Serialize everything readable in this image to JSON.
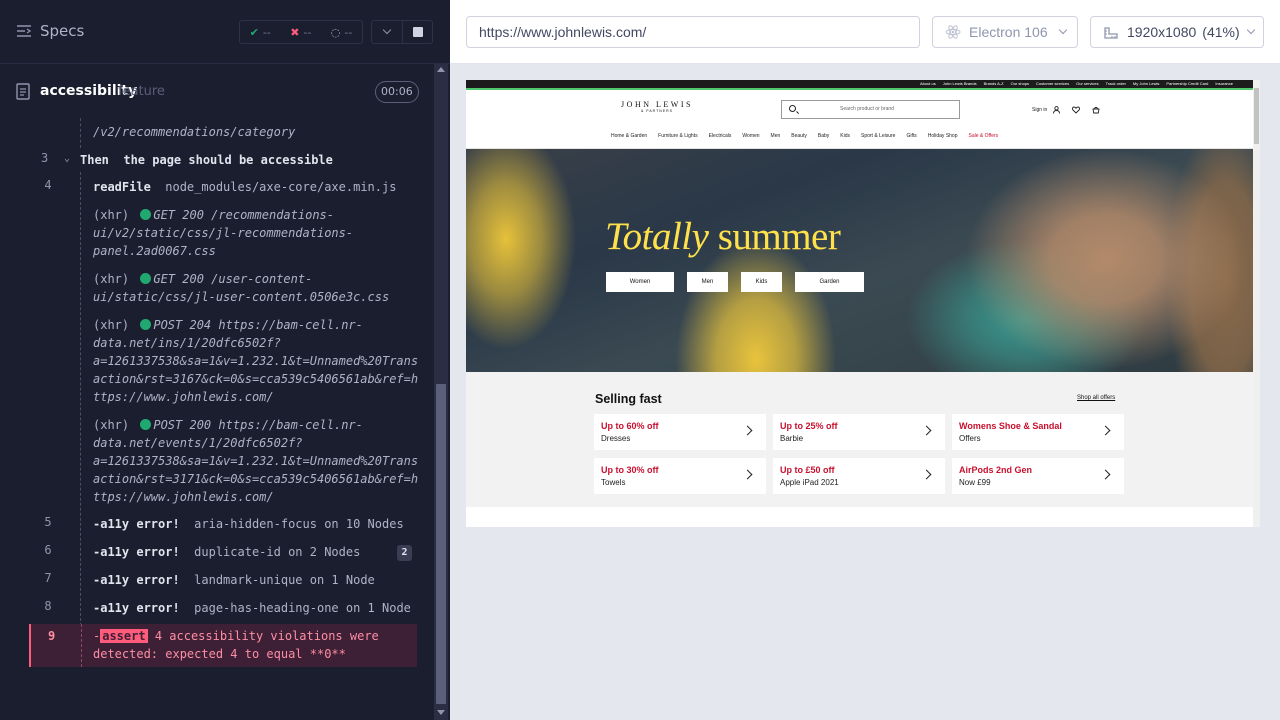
{
  "reporter": {
    "specs_label": "Specs",
    "stats": {
      "passed": "--",
      "failed": "--",
      "pending": "--"
    },
    "file": {
      "name": "accessibility",
      "ext": "feature",
      "duration": "00:06"
    },
    "log": {
      "prev_tail": "/v2/recommendations/category",
      "step3": {
        "num": "3",
        "keyword": "Then",
        "text": "the page should be accessible"
      },
      "step4": {
        "num": "4",
        "command": "readFile",
        "arg": "node_modules/axe-core/axe.min.js"
      },
      "xhr_label": "(xhr)",
      "xhr": [
        {
          "method": "GET 200",
          "lines": [
            "/recommendations-",
            "ui/v2/static/css/jl-recommendations-",
            "panel.2ad0067.css"
          ]
        },
        {
          "method": "GET 200",
          "lines": [
            "/user-content-",
            "ui/static/css/jl-user-content.0506e3c.css"
          ]
        },
        {
          "method": "POST 204",
          "lines": [
            "https://bam-cell.nr-",
            "data.net/ins/1/20dfc6502f?",
            "a=1261337538&sa=1&v=1.232.1&t=Unnamed%20Trans",
            "action&rst=3167&ck=0&s=cca539c5406561ab&ref=h",
            "ttps://www.johnlewis.com/"
          ]
        },
        {
          "method": "POST 200",
          "lines": [
            "https://bam-cell.nr-",
            "data.net/events/1/20dfc6502f?",
            "a=1261337538&sa=1&v=1.232.1&t=Unnamed%20Trans",
            "action&rst=3171&ck=0&s=cca539c5406561ab&ref=h",
            "ttps://www.johnlewis.com/"
          ]
        }
      ],
      "errors": [
        {
          "num": "5",
          "label": "-a11y error!",
          "msg": "aria-hidden-focus on 10 Nodes"
        },
        {
          "num": "6",
          "label": "-a11y error!",
          "msg": "duplicate-id on 2 Nodes",
          "badge": "2"
        },
        {
          "num": "7",
          "label": "-a11y error!",
          "msg": "landmark-unique on 1 Node"
        },
        {
          "num": "8",
          "label": "-a11y error!",
          "msg": "page-has-heading-one on 1 Node"
        }
      ],
      "assert": {
        "num": "9",
        "prefix": "-",
        "label": "assert",
        "line1": " 4 accessibility violations were",
        "line2": "detected: expected 4 to equal **0**"
      }
    }
  },
  "aut_header": {
    "url": "https://www.johnlewis.com/",
    "browser": "Electron 106",
    "viewport": "1920x1080",
    "scale": "(41%)"
  },
  "site": {
    "top_links": [
      "About us",
      "John Lewis Brands",
      "Brands A-Z",
      "Our shops",
      "Customer services",
      "Our services",
      "Track order",
      "My John Lewis",
      "Partnership Credit Card",
      "Insurance"
    ],
    "logo_line1": "JOHN LEWIS",
    "logo_line2": "& PARTNERS",
    "search_placeholder": "Search product or brand",
    "sign_in": "Sign in",
    "nav": [
      "Home & Garden",
      "Furniture & Lights",
      "Electricals",
      "Women",
      "Men",
      "Beauty",
      "Baby",
      "Kids",
      "Sport & Leisure",
      "Gifts",
      "Holiday Shop",
      "Sale & Offers"
    ],
    "hero": {
      "title_italic": "Totally",
      "title_rest": "summer",
      "buttons": [
        "Women",
        "Men",
        "Kids",
        "Garden"
      ]
    },
    "selling_fast": {
      "title": "Selling fast",
      "shop_all": "Shop all offers",
      "deals": [
        {
          "headline": "Up to 60% off",
          "sub": "Dresses"
        },
        {
          "headline": "Up to 25% off",
          "sub": "Barbie"
        },
        {
          "headline": "Womens Shoe & Sandal",
          "sub": "Offers"
        },
        {
          "headline": "Up to 30% off",
          "sub": "Towels"
        },
        {
          "headline": "Up to £50 off",
          "sub": "Apple iPad 2021"
        },
        {
          "headline": "AirPods 2nd Gen",
          "sub": "Now £99"
        }
      ]
    }
  },
  "colors": {
    "pass": "#1fa971",
    "fail": "#ff5c7b",
    "sale_red": "#c8102e",
    "hero_title": "#ffe14b"
  }
}
